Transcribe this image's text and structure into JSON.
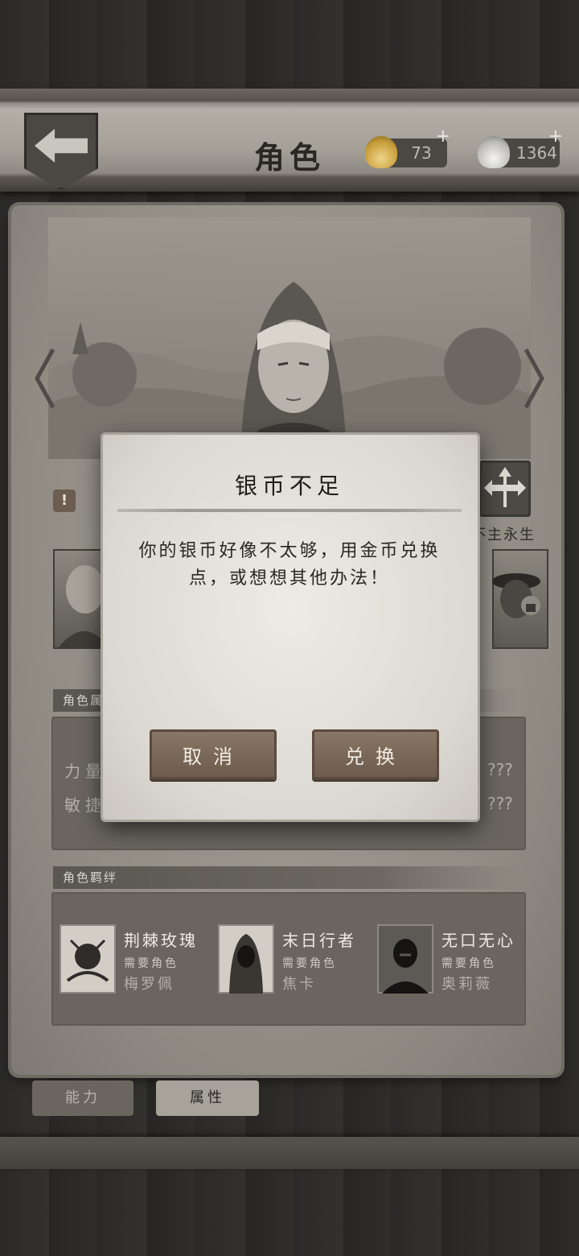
{
  "header": {
    "title": "角色",
    "gold": {
      "amount": "73",
      "plus": "+"
    },
    "silver": {
      "amount": "1364",
      "plus": "+"
    }
  },
  "character": {
    "skill_label": "不主永生",
    "warning": "!"
  },
  "attributes": {
    "header": "角色属性",
    "rows": [
      {
        "label": "力量",
        "value": "???"
      },
      {
        "label": "敏捷",
        "value": "???"
      }
    ]
  },
  "bonds": {
    "header": "角色羁绊",
    "items": [
      {
        "name": "荆棘玫瑰",
        "req": "需要角色",
        "who": "梅罗佩"
      },
      {
        "name": "末日行者",
        "req": "需要角色",
        "who": "焦卡"
      },
      {
        "name": "无口无心",
        "req": "需要角色",
        "who": "奥莉薇"
      }
    ]
  },
  "tabs": [
    {
      "label": "能力"
    },
    {
      "label": "属性"
    }
  ],
  "dialog": {
    "title": "银币不足",
    "message": "你的银币好像不太够，用金币兑换点，或想想其他办法！",
    "cancel_label": "取消",
    "confirm_label": "兑换"
  }
}
